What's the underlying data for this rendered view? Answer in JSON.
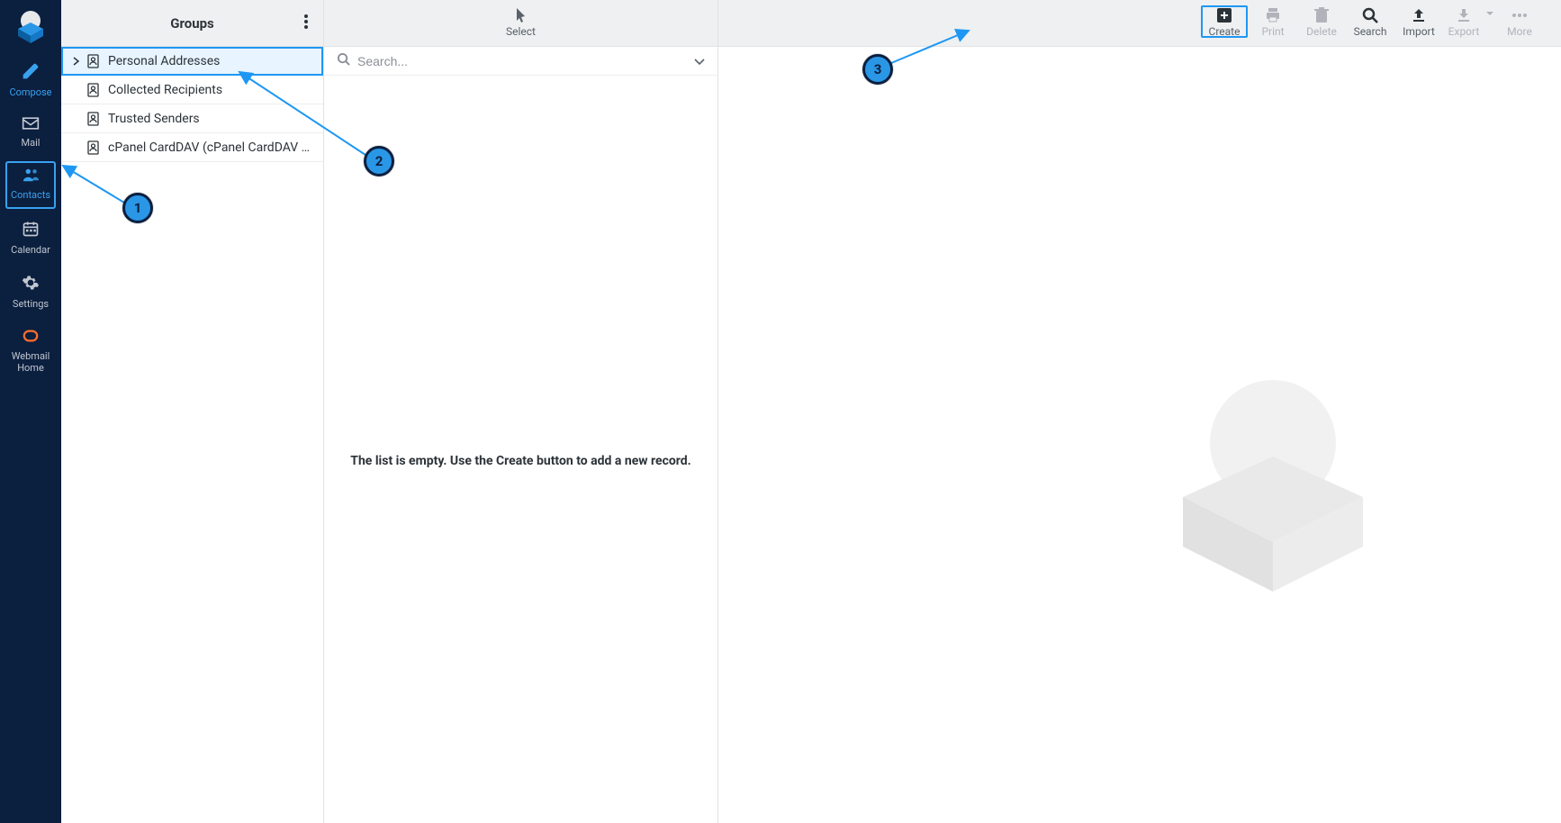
{
  "sidebar": {
    "items": [
      {
        "label": "Compose"
      },
      {
        "label": "Mail"
      },
      {
        "label": "Contacts"
      },
      {
        "label": "Calendar"
      },
      {
        "label": "Settings"
      },
      {
        "label": "Webmail Home"
      }
    ]
  },
  "groups": {
    "title": "Groups",
    "items": [
      {
        "label": "Personal Addresses"
      },
      {
        "label": "Collected Recipients"
      },
      {
        "label": "Trusted Senders"
      },
      {
        "label": "cPanel CardDAV (cPanel CardDAV Address…"
      }
    ]
  },
  "list": {
    "select_label": "Select",
    "search_placeholder": "Search...",
    "empty_message": "The list is empty. Use the Create button to add a new record."
  },
  "detail_toolbar": {
    "create": "Create",
    "print": "Print",
    "delete": "Delete",
    "search": "Search",
    "import": "Import",
    "export": "Export",
    "more": "More"
  },
  "annotations": {
    "one": "1",
    "two": "2",
    "three": "3"
  }
}
